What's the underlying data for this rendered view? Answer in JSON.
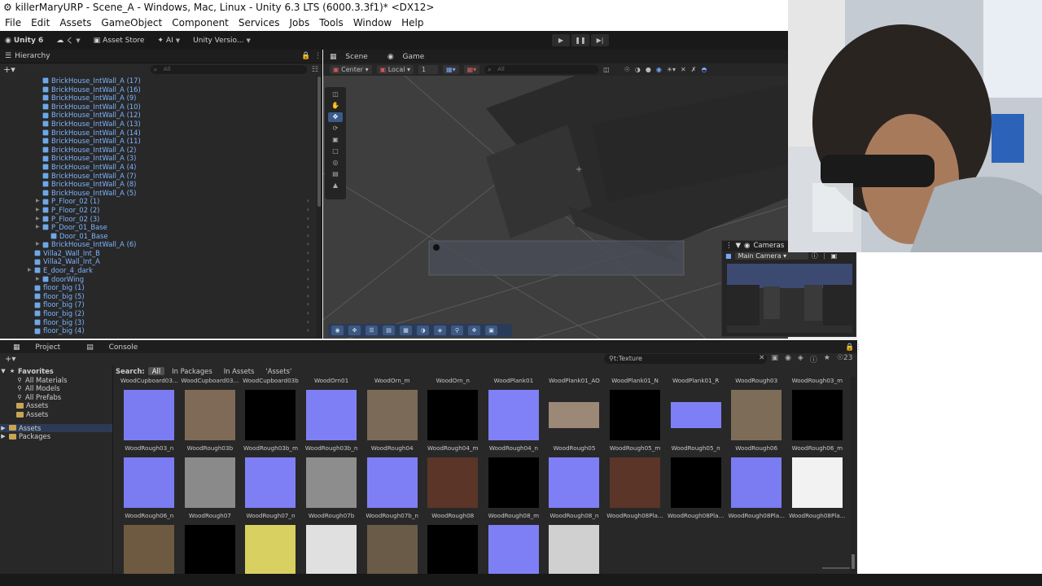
{
  "window": {
    "title": "killerMaryURP - Scene_A - Windows, Mac, Linux - Unity 6.3 LTS (6000.3.3f1)* <DX12>",
    "menu": [
      "File",
      "Edit",
      "Assets",
      "GameObject",
      "Component",
      "Services",
      "Jobs",
      "Tools",
      "Window",
      "Help"
    ]
  },
  "toolbar": {
    "unity_label": "Unity 6",
    "account_label": "く",
    "asset_store": "Asset Store",
    "ai": "AI",
    "version_control": "Unity Versio..."
  },
  "hierarchy": {
    "tab": "Hierarchy",
    "search_placeholder": "All",
    "rows": [
      {
        "label": "BrickHouse_IntWall_A (17)",
        "indent": 2
      },
      {
        "label": "BrickHouse_IntWall_A (16)",
        "indent": 2
      },
      {
        "label": "BrickHouse_IntWall_A (9)",
        "indent": 2
      },
      {
        "label": "BrickHouse_IntWall_A (10)",
        "indent": 2
      },
      {
        "label": "BrickHouse_IntWall_A (12)",
        "indent": 2
      },
      {
        "label": "BrickHouse_IntWall_A (13)",
        "indent": 2
      },
      {
        "label": "BrickHouse_IntWall_A (14)",
        "indent": 2
      },
      {
        "label": "BrickHouse_IntWall_A (11)",
        "indent": 2
      },
      {
        "label": "BrickHouse_IntWall_A (2)",
        "indent": 2
      },
      {
        "label": "BrickHouse_IntWall_A (3)",
        "indent": 2
      },
      {
        "label": "BrickHouse_IntWall_A (4)",
        "indent": 2
      },
      {
        "label": "BrickHouse_IntWall_A (7)",
        "indent": 2
      },
      {
        "label": "BrickHouse_IntWall_A (8)",
        "indent": 2
      },
      {
        "label": "BrickHouse_IntWall_A (5)",
        "indent": 2
      },
      {
        "label": "P_Floor_02 (1)",
        "indent": 2
      },
      {
        "label": "P_Floor_02 (2)",
        "indent": 2
      },
      {
        "label": "P_Floor_02 (3)",
        "indent": 2
      },
      {
        "label": "P_Door_01_Base",
        "indent": 2
      },
      {
        "label": "Door_01_Base",
        "indent": 3
      },
      {
        "label": "BrickHouse_IntWall_A (6)",
        "indent": 2
      },
      {
        "label": "Villa2_Wall_Int_B",
        "indent": 1
      },
      {
        "label": "Villa2_Wall_Int_A",
        "indent": 1
      },
      {
        "label": "E_door_4_dark",
        "indent": 1
      },
      {
        "label": "doorWing",
        "indent": 2
      },
      {
        "label": "floor_big (1)",
        "indent": 1
      },
      {
        "label": "floor_big (5)",
        "indent": 1
      },
      {
        "label": "floor_big (7)",
        "indent": 1
      },
      {
        "label": "floor_big (2)",
        "indent": 1
      },
      {
        "label": "floor_big (3)",
        "indent": 1
      },
      {
        "label": "floor_big (4)",
        "indent": 1
      }
    ]
  },
  "scene": {
    "tabs": [
      "Scene",
      "Game"
    ],
    "pivot": "Center",
    "space": "Local",
    "grid_snap": "1",
    "search_placeholder": "All"
  },
  "cameras": {
    "title": "Cameras",
    "selected": "Main Camera"
  },
  "project": {
    "tabs": [
      "Project",
      "Console"
    ],
    "search_value": "t:Texture",
    "count": "23",
    "favorites_label": "Favorites",
    "favorites": [
      "All Materials",
      "All Models",
      "All Prefabs",
      "Assets",
      "Assets"
    ],
    "roots": [
      "Assets",
      "Packages"
    ],
    "search_label": "Search:",
    "filters": [
      "All",
      "In Packages",
      "In Assets",
      "'Assets'"
    ],
    "top_labels": [
      "WoodCupboard03...",
      "WoodCupboard03...",
      "WoodCupboard03b",
      "WoodOrn01",
      "WoodOrn_m",
      "WoodOrn_n",
      "WoodPlank01",
      "WoodPlank01_AO",
      "WoodPlank01_N",
      "WoodPlank01_R",
      "WoodRough03",
      "WoodRough03_m"
    ],
    "row1": [
      {
        "name": "WoodRough03_n",
        "color": "#7b7cf2"
      },
      {
        "name": "WoodRough03b",
        "color": "#7e6a56"
      },
      {
        "name": "WoodRough03b_m",
        "color": "#000000"
      },
      {
        "name": "WoodRough03b_n",
        "color": "#7f7ff5"
      },
      {
        "name": "WoodRough04",
        "color": "#7b6a58"
      },
      {
        "name": "WoodRough04_m",
        "color": "#000000"
      },
      {
        "name": "WoodRough04_n",
        "color": "#8080f7"
      },
      {
        "name": "WoodRough05",
        "color": "#9c8877"
      },
      {
        "name": "WoodRough05_m",
        "color": "#000000"
      },
      {
        "name": "WoodRough05_n",
        "color": "#7f7ff5"
      },
      {
        "name": "WoodRough06",
        "color": "#7d6c58"
      },
      {
        "name": "WoodRough06_m",
        "color": "#000000"
      }
    ],
    "row2": [
      {
        "name": "WoodRough06_n",
        "color": "#7b7cf2"
      },
      {
        "name": "WoodRough07",
        "color": "#8a8a8a"
      },
      {
        "name": "WoodRough07_n",
        "color": "#7f7ff5"
      },
      {
        "name": "WoodRough07b",
        "color": "#8d8d8d"
      },
      {
        "name": "WoodRough07b_n",
        "color": "#7f7ff5"
      },
      {
        "name": "WoodRough08",
        "color": "#5a3528"
      },
      {
        "name": "WoodRough08_m",
        "color": "#000000"
      },
      {
        "name": "WoodRough08_n",
        "color": "#7f7ff5"
      },
      {
        "name": "WoodRough08Pla...",
        "color": "#5a3528"
      },
      {
        "name": "WoodRough08Pla...",
        "color": "#000000"
      },
      {
        "name": "WoodRough08Pla...",
        "color": "#7b7cf2"
      },
      {
        "name": "WoodRough08Pla...",
        "color": "#f2f2f2"
      }
    ],
    "row3_colors": [
      "#6e5a40",
      "#000000",
      "#d8d060",
      "#e0e0e0",
      "#6a5a48",
      "#000000",
      "#7f7ff5",
      "#d0d0d0"
    ]
  }
}
